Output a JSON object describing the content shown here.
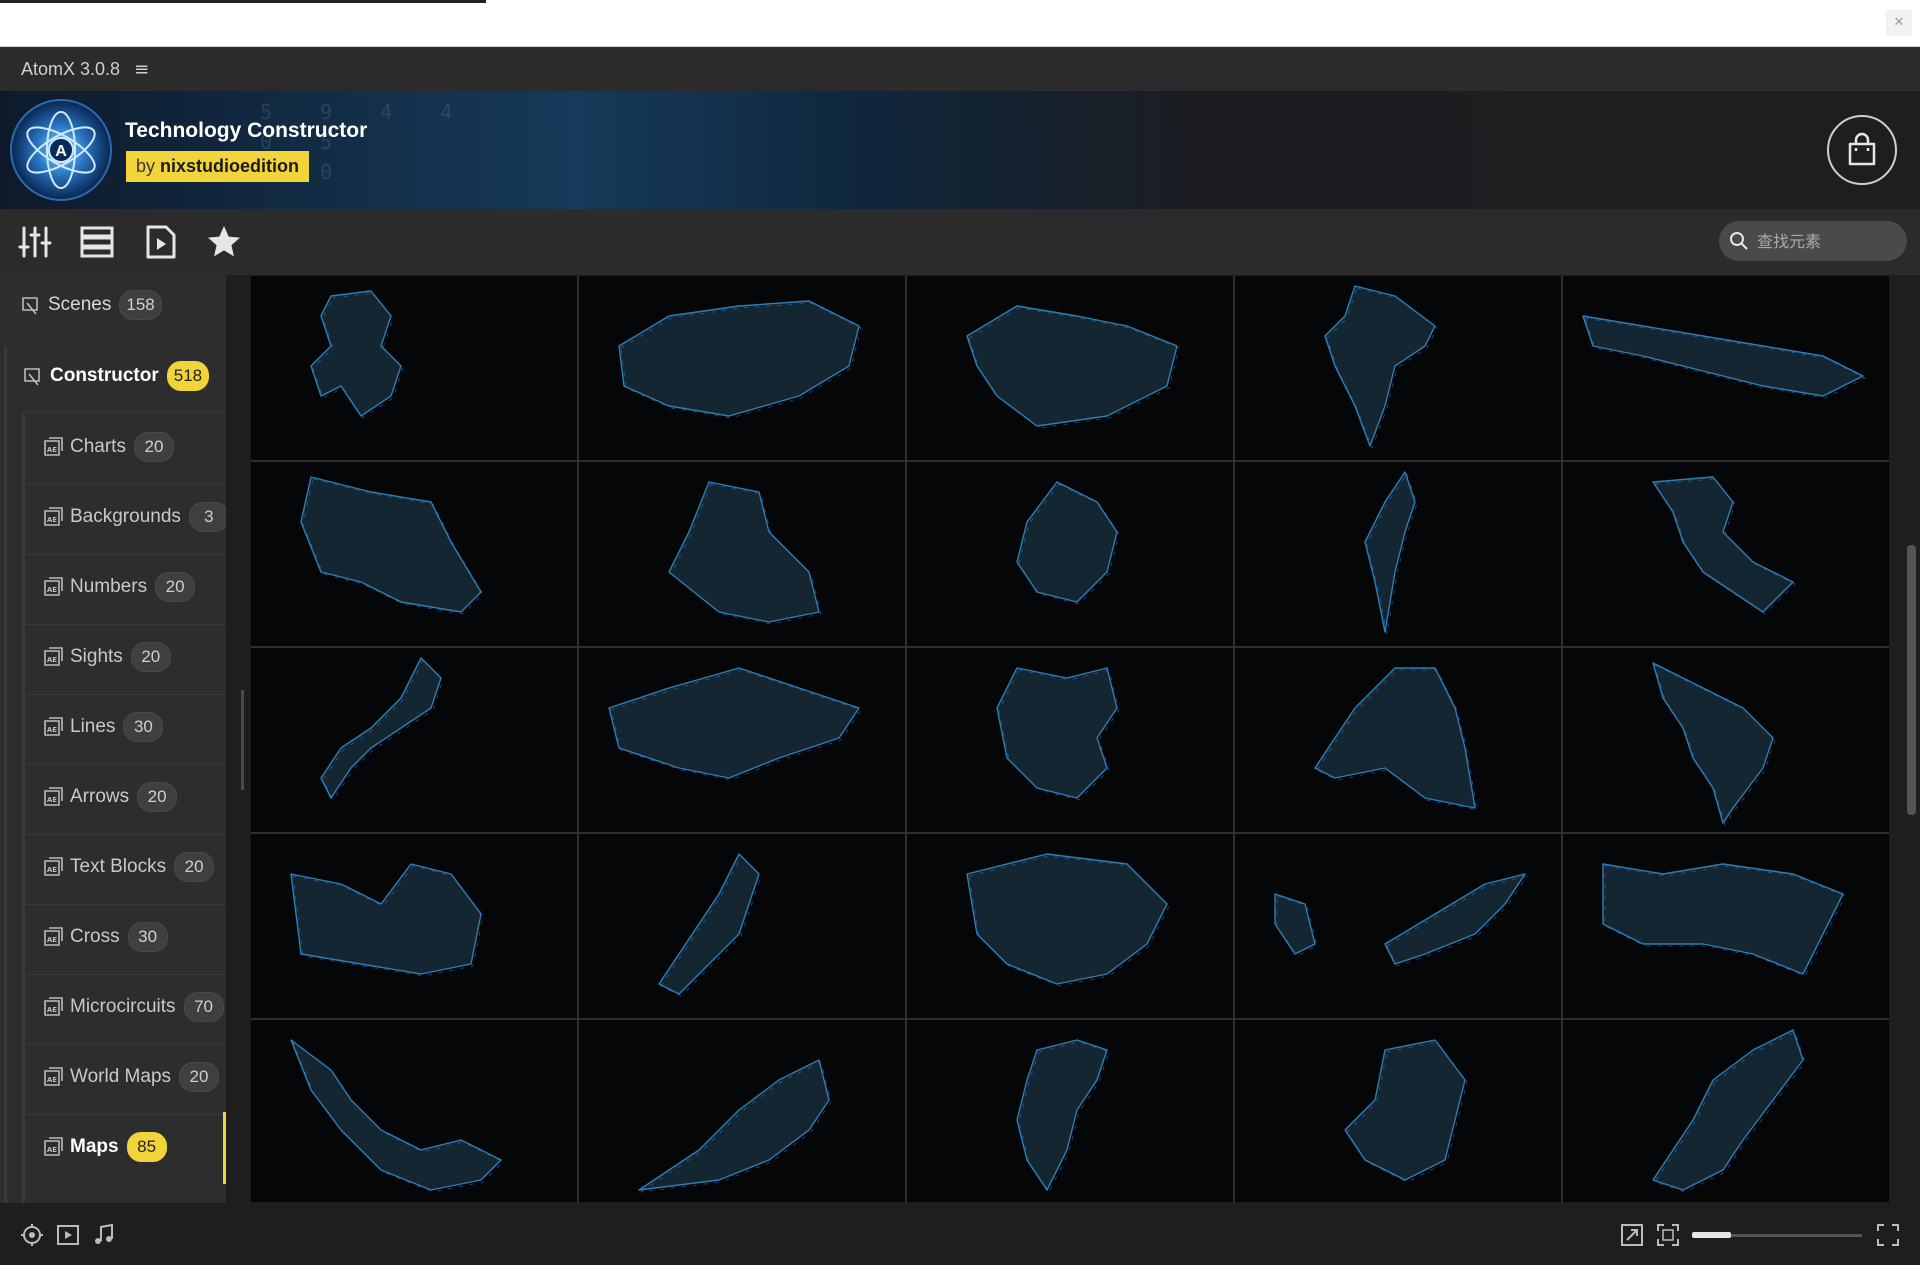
{
  "window": {
    "app_title": "AtomX 3.0.8",
    "menu_icon": "hamburger-icon",
    "close_icon": "close-icon"
  },
  "banner": {
    "title": "Technology Constructor",
    "author_prefix": "by",
    "author_name": "nixstudioedition",
    "accent_color": "#f0d43a",
    "cart_icon": "shopping-bag-icon",
    "logo_icon": "atom-logo-icon",
    "background_digits": "5 9 4 4\n0 5\nF 0"
  },
  "toolbar": {
    "tools": [
      {
        "name": "sliders-icon"
      },
      {
        "name": "list-view-icon"
      },
      {
        "name": "video-play-icon"
      },
      {
        "name": "star-icon"
      }
    ],
    "search": {
      "placeholder": "查找元素",
      "value": ""
    }
  },
  "sidebar": {
    "top_items": [
      {
        "label": "Scenes",
        "count": "158",
        "active": false
      },
      {
        "label": "Constructor",
        "count": "518",
        "active": true
      }
    ],
    "sub_items": [
      {
        "label": "Charts",
        "count": "20"
      },
      {
        "label": "Backgrounds",
        "count": "3"
      },
      {
        "label": "Numbers",
        "count": "20"
      },
      {
        "label": "Sights",
        "count": "20"
      },
      {
        "label": "Lines",
        "count": "30"
      },
      {
        "label": "Arrows",
        "count": "20"
      },
      {
        "label": "Text Blocks",
        "count": "20"
      },
      {
        "label": "Cross",
        "count": "30"
      },
      {
        "label": "Microcircuits",
        "count": "70"
      },
      {
        "label": "World Maps",
        "count": "20"
      },
      {
        "label": "Maps",
        "count": "85",
        "active": true
      }
    ]
  },
  "grid": {
    "columns": 5,
    "tiles": [
      "map-thumbnail",
      "map-thumbnail",
      "map-thumbnail",
      "map-thumbnail",
      "map-thumbnail",
      "map-thumbnail",
      "map-thumbnail",
      "map-thumbnail",
      "map-thumbnail",
      "map-thumbnail",
      "map-thumbnail",
      "map-thumbnail",
      "map-thumbnail",
      "map-thumbnail",
      "map-thumbnail",
      "map-thumbnail",
      "map-thumbnail",
      "map-thumbnail",
      "map-thumbnail",
      "map-thumbnail",
      "map-thumbnail",
      "map-thumbnail",
      "map-thumbnail",
      "map-thumbnail",
      "map-thumbnail"
    ],
    "map_fill": "#152633",
    "map_border": "#2f7fb0",
    "map_highlight": "#2d6cf0"
  },
  "bottombar": {
    "left_icons": [
      "target-icon",
      "play-square-icon",
      "music-note-icon"
    ],
    "right_icons": [
      "expand-icon",
      "fit-screen-icon",
      "fullscreen-icon"
    ],
    "zoom_level": 0.23
  }
}
